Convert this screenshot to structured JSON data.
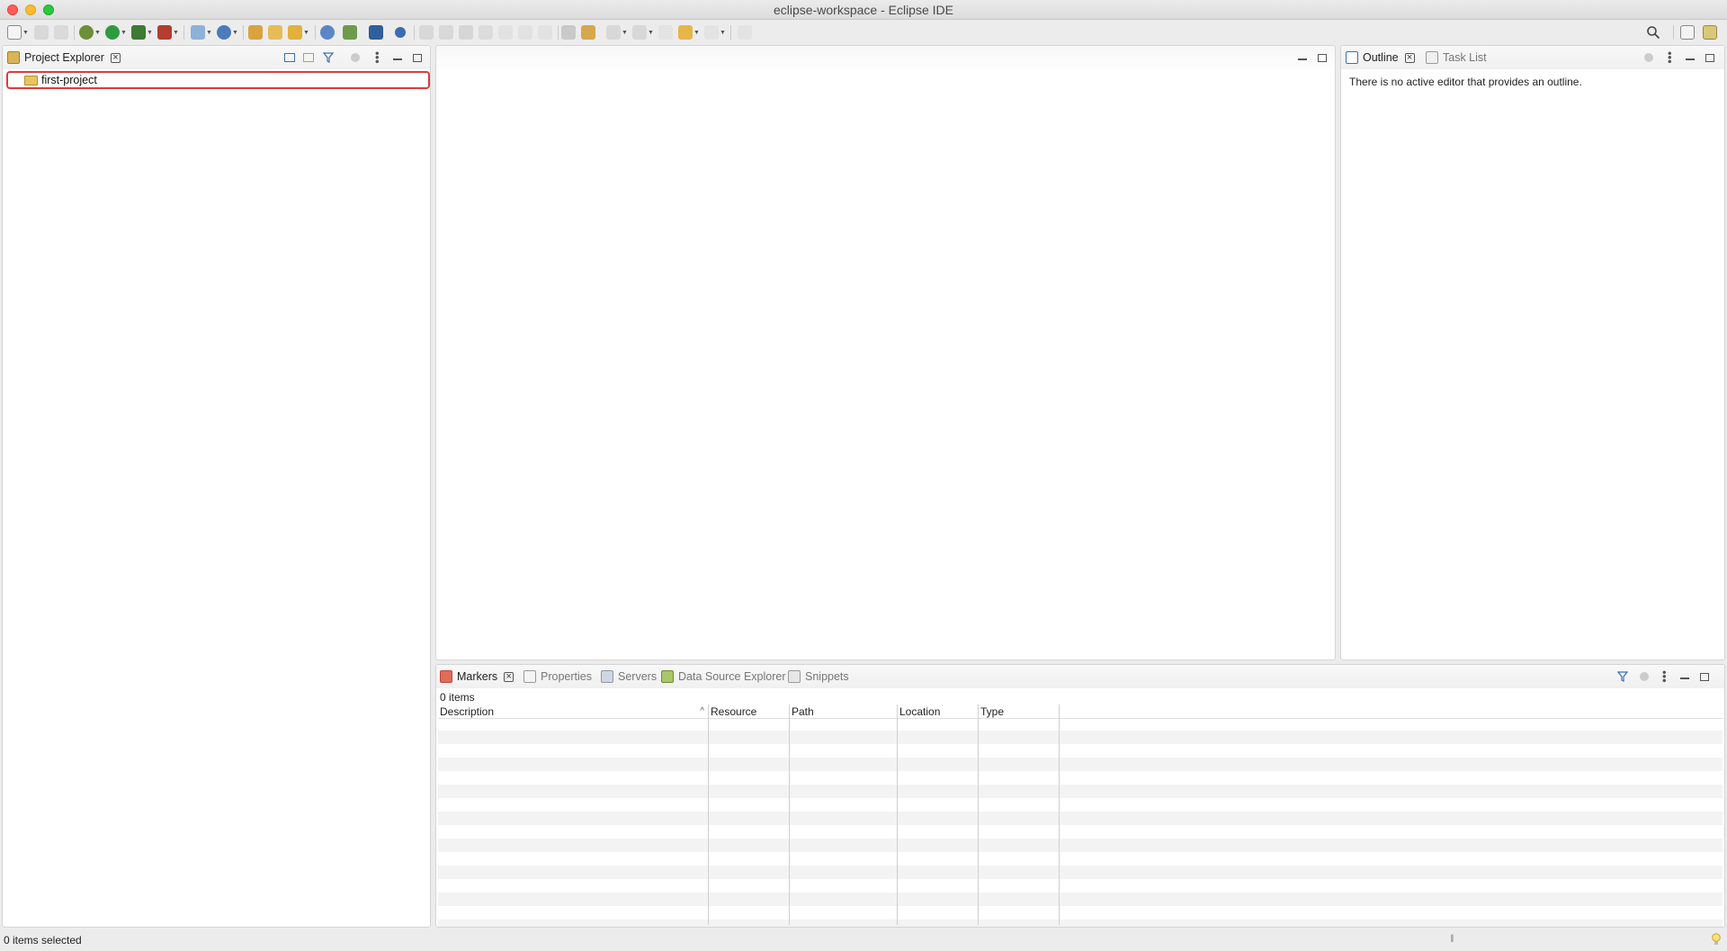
{
  "window": {
    "title": "eclipse-workspace - Eclipse IDE"
  },
  "toolbar": {
    "buttons": [
      "new-wizard",
      "save",
      "save-all",
      "debug",
      "run",
      "coverage",
      "external-tools",
      "new-java-project",
      "new-server",
      "open-type",
      "open-task",
      "search",
      "web-browser",
      "deploy",
      "terminal",
      "skip-breakpoints",
      "resume",
      "suspend",
      "terminate",
      "disconnect",
      "step-into",
      "step-over",
      "step-return",
      "toggle-mark-occurrences",
      "show-whitespace",
      "next-annotation",
      "previous-annotation",
      "last-edit-location",
      "back",
      "forward",
      "pin-editor"
    ],
    "right": [
      "search-icon",
      "open-perspective-icon",
      "java-ee-perspective-icon"
    ]
  },
  "project_explorer": {
    "tab_label": "Project Explorer",
    "items": [
      {
        "label": "first-project",
        "icon": "open-folder-icon"
      }
    ]
  },
  "outline": {
    "tab_label": "Outline",
    "tab2_label": "Task List",
    "message": "There is no active editor that provides an outline."
  },
  "bottom": {
    "tabs": [
      {
        "label": "Markers",
        "active": true
      },
      {
        "label": "Properties",
        "active": false
      },
      {
        "label": "Servers",
        "active": false
      },
      {
        "label": "Data Source Explorer",
        "active": false
      },
      {
        "label": "Snippets",
        "active": false
      }
    ],
    "items_count": "0 items",
    "columns": [
      "Description",
      "Resource",
      "Path",
      "Location",
      "Type"
    ]
  },
  "status": {
    "text": "0 items selected"
  },
  "colors": {
    "highlight_border": "#e03a3a",
    "folder": "#e9c463",
    "row_alt": "#f3f3f3"
  }
}
